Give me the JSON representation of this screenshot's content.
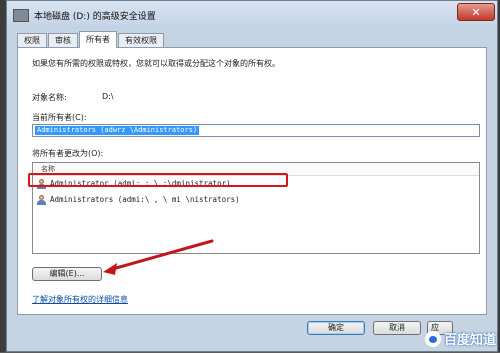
{
  "window": {
    "title": "本地磁盘 (D:) 的高级安全设置",
    "close_label": "✕"
  },
  "tabs": [
    {
      "label": "权限"
    },
    {
      "label": "审核"
    },
    {
      "label": "所有者"
    },
    {
      "label": "有效权限"
    }
  ],
  "panel": {
    "intro": "如果您有所需的权限或特权，您就可以取得或分配这个对象的所有权。",
    "object_name_label": "对象名称:",
    "object_name_value": "D:\\",
    "current_owner_label": "当前所有者(C):",
    "current_owner_value": "Administrators (adwrz \\Administrators)",
    "change_owner_label": "将所有者更改为(O):",
    "list_header": "名称",
    "list_items": [
      {
        "text": "Administrator (admi: ;   \\ ;\\dministrator)"
      },
      {
        "text": "Administrators (admi:\\  , \\   mi \\nistrators)"
      }
    ],
    "edit_button": "编辑(E)...",
    "link": "了解对象所有权的详细信息"
  },
  "footer": {
    "ok": "确定",
    "cancel": "取消",
    "apply": "应"
  },
  "watermark": {
    "text": "百度知道"
  },
  "colors": {
    "highlight": "#d8161a",
    "arrow": "#c0181c",
    "selection": "#3399ff"
  }
}
